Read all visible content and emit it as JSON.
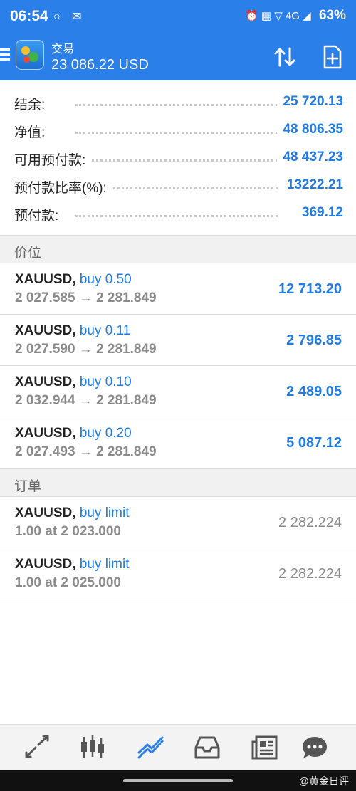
{
  "status_bar": {
    "time": "06:54",
    "left_icons": "○ ✉",
    "right_icons": "⏰ ▦ ▽ 4G ◢",
    "battery": "63%"
  },
  "app_bar": {
    "title": "交易",
    "balance": "23 086.22 USD"
  },
  "summary": [
    {
      "label": "结余:",
      "value": "25 720.13"
    },
    {
      "label": "净值:",
      "value": "48 806.35"
    },
    {
      "label": "可用预付款:",
      "value": "48 437.23"
    },
    {
      "label": "预付款比率(%):",
      "value": "13222.21"
    },
    {
      "label": "预付款:",
      "value": "369.12"
    }
  ],
  "positions_header": "价位",
  "positions": [
    {
      "symbol": "XAUUSD,",
      "side": " buy 0.50",
      "prices": "2 027.585 → 2 281.849",
      "profit": "12 713.20"
    },
    {
      "symbol": "XAUUSD,",
      "side": " buy 0.11",
      "prices": "2 027.590 → 2 281.849",
      "profit": "2 796.85"
    },
    {
      "symbol": "XAUUSD,",
      "side": " buy 0.10",
      "prices": "2 032.944 → 2 281.849",
      "profit": "2 489.05"
    },
    {
      "symbol": "XAUUSD,",
      "side": " buy 0.20",
      "prices": "2 027.493 → 2 281.849",
      "profit": "5 087.12"
    }
  ],
  "orders_header": "订单",
  "orders": [
    {
      "symbol": "XAUUSD,",
      "side": " buy limit",
      "detail": "1.00 at 2 023.000",
      "price": "2 282.224"
    },
    {
      "symbol": "XAUUSD,",
      "side": " buy limit",
      "detail": "1.00 at 2 025.000",
      "price": "2 282.224"
    }
  ],
  "tabs": [
    "quotes-icon",
    "chart-icon",
    "trade-icon",
    "history-icon",
    "news-icon",
    "chat-icon"
  ],
  "colors": {
    "accent": "#2b7fe8",
    "value_blue": "#1f7be0",
    "active_tab": "#2b7fe8",
    "inactive_tab": "#555555"
  },
  "watermark": "@黄金日评"
}
